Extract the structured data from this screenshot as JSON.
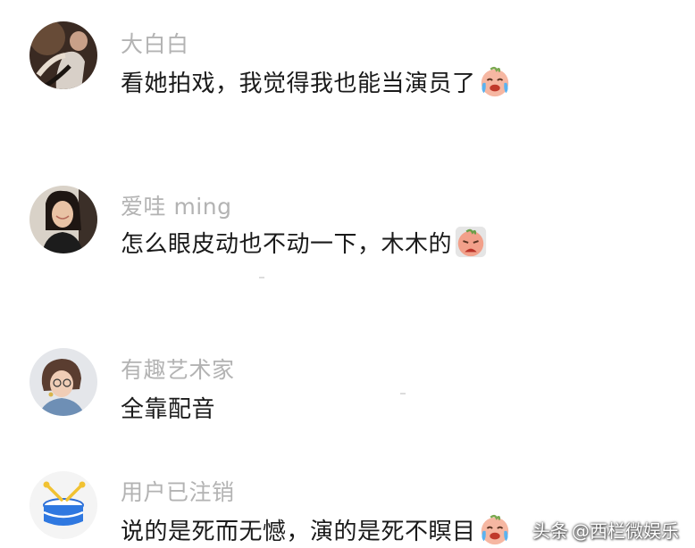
{
  "comments": [
    {
      "username": "大白白",
      "text": "看她拍戏，我觉得我也能当演员了",
      "emoji": "crying-laughing-emoji",
      "avatar": "dancer-avatar"
    },
    {
      "username": "爱哇 ming",
      "text": "怎么眼皮动也不动一下，木木的",
      "emoji": "sobbing-emoji",
      "avatar": "woman-portrait-avatar"
    },
    {
      "username": "有趣艺术家",
      "text": "全靠配音",
      "emoji": "",
      "avatar": "short-hair-person-avatar"
    },
    {
      "username": "用户已注销",
      "text": "说的是死而无憾，演的是死不瞑目",
      "emoji": "crying-laughing-emoji",
      "avatar": "drum-icon-avatar"
    }
  ],
  "watermark": {
    "prefix": "头条",
    "text": "@西栏微娱乐"
  },
  "colors": {
    "username": "#b3b3b3",
    "text": "#1a1a1a",
    "background": "#ffffff"
  }
}
